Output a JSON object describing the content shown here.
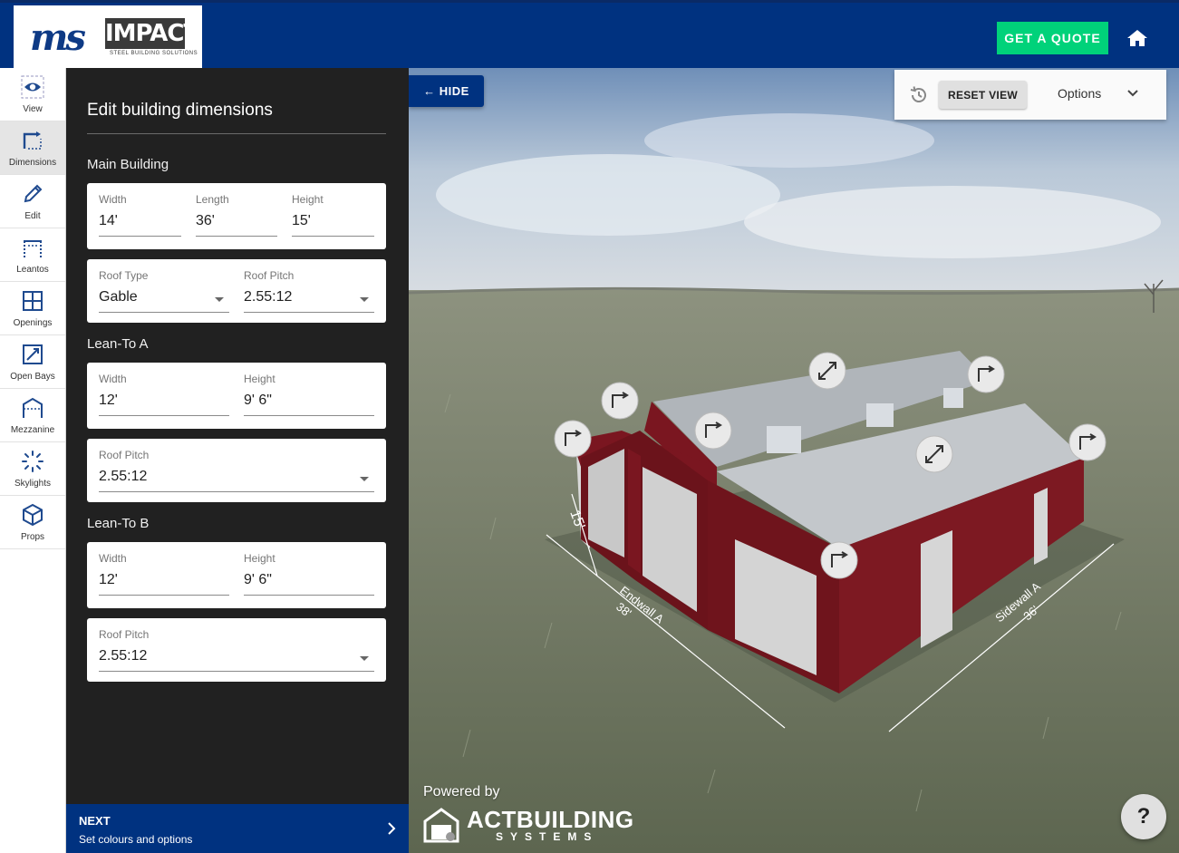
{
  "header": {
    "logo_primary": "ms",
    "logo_secondary": "IMPACT",
    "logo_tagline": "STEEL BUILDING SOLUTIONS",
    "quote_label": "GET A QUOTE",
    "home_icon": "home-icon"
  },
  "nav": {
    "items": [
      {
        "label": "View",
        "icon": "eye-icon",
        "active": false
      },
      {
        "label": "Dimensions",
        "icon": "dimensions-icon",
        "active": true
      },
      {
        "label": "Edit",
        "icon": "pencil-icon",
        "active": false
      },
      {
        "label": "Leantos",
        "icon": "leanto-icon",
        "active": false
      },
      {
        "label": "Openings",
        "icon": "openings-icon",
        "active": false
      },
      {
        "label": "Open Bays",
        "icon": "open-bays-icon",
        "active": false
      },
      {
        "label": "Mezzanine",
        "icon": "mezzanine-icon",
        "active": false
      },
      {
        "label": "Skylights",
        "icon": "skylights-icon",
        "active": false
      },
      {
        "label": "Props",
        "icon": "cube-icon",
        "active": false
      }
    ]
  },
  "panel": {
    "title": "Edit building dimensions",
    "main": {
      "label": "Main Building",
      "width_label": "Width",
      "width": "14'",
      "length_label": "Length",
      "length": "36'",
      "height_label": "Height",
      "height": "15'",
      "roof_type_label": "Roof Type",
      "roof_type": "Gable",
      "roof_pitch_label": "Roof Pitch",
      "roof_pitch": "2.55:12"
    },
    "leanto_a": {
      "label": "Lean-To A",
      "width_label": "Width",
      "width": "12'",
      "height_label": "Height",
      "height": "9' 6\"",
      "roof_pitch_label": "Roof Pitch",
      "roof_pitch": "2.55:12"
    },
    "leanto_b": {
      "label": "Lean-To B",
      "width_label": "Width",
      "width": "12'",
      "height_label": "Height",
      "height": "9' 6\"",
      "roof_pitch_label": "Roof Pitch",
      "roof_pitch": "2.55:12"
    }
  },
  "next": {
    "title": "NEXT",
    "subtitle": "Set colours and options"
  },
  "viewport": {
    "hide_label": "← HIDE",
    "reset_label": "RESET VIEW",
    "options_label": "Options",
    "dim_height": "15'",
    "endwall_label": "Endwall A",
    "endwall_value": "38'",
    "sidewall_label": "Sidewall A",
    "sidewall_value": "36'",
    "powered_by": "Powered by",
    "brand": "ACTBUILDING",
    "brand_sub": "SYSTEMS",
    "help_label": "?"
  },
  "colors": {
    "brand_blue": "#003280",
    "quote_green": "#00d27a",
    "panel_bg": "#212121",
    "building_red": "#7a1620"
  }
}
